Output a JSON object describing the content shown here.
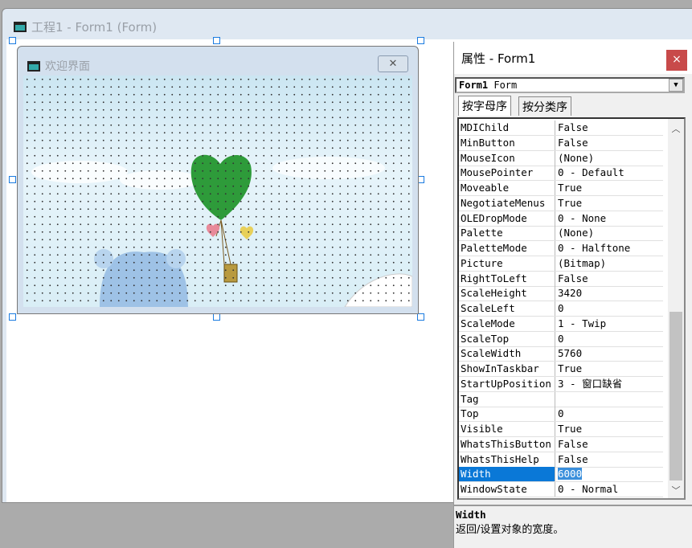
{
  "project_window": {
    "title": "工程1 - Form1 (Form)"
  },
  "form": {
    "title": "欢迎界面",
    "close": "✕"
  },
  "properties": {
    "title": "属性 - Form1",
    "close": "×",
    "object_name": "Form1",
    "object_type": "Form",
    "tabs": [
      "按字母序",
      "按分类序"
    ],
    "rows": [
      {
        "name": "MDIChild",
        "value": "False"
      },
      {
        "name": "MinButton",
        "value": "False"
      },
      {
        "name": "MouseIcon",
        "value": "(None)"
      },
      {
        "name": "MousePointer",
        "value": "0 - Default"
      },
      {
        "name": "Moveable",
        "value": "True"
      },
      {
        "name": "NegotiateMenus",
        "value": "True"
      },
      {
        "name": "OLEDropMode",
        "value": "0 - None"
      },
      {
        "name": "Palette",
        "value": "(None)"
      },
      {
        "name": "PaletteMode",
        "value": "0 - Halftone"
      },
      {
        "name": "Picture",
        "value": "(Bitmap)"
      },
      {
        "name": "RightToLeft",
        "value": "False"
      },
      {
        "name": "ScaleHeight",
        "value": "3420"
      },
      {
        "name": "ScaleLeft",
        "value": "0"
      },
      {
        "name": "ScaleMode",
        "value": "1 - Twip"
      },
      {
        "name": "ScaleTop",
        "value": "0"
      },
      {
        "name": "ScaleWidth",
        "value": "5760"
      },
      {
        "name": "ShowInTaskbar",
        "value": "True"
      },
      {
        "name": "StartUpPosition",
        "value": "3 - 窗口缺省"
      },
      {
        "name": "Tag",
        "value": ""
      },
      {
        "name": "Top",
        "value": "0"
      },
      {
        "name": "Visible",
        "value": "True"
      },
      {
        "name": "WhatsThisButton",
        "value": "False"
      },
      {
        "name": "WhatsThisHelp",
        "value": "False"
      },
      {
        "name": "Width",
        "value": "6000",
        "selected": true
      },
      {
        "name": "WindowState",
        "value": "0 - Normal"
      }
    ],
    "description": {
      "name": "Width",
      "text": "返回/设置对象的宽度。"
    }
  }
}
